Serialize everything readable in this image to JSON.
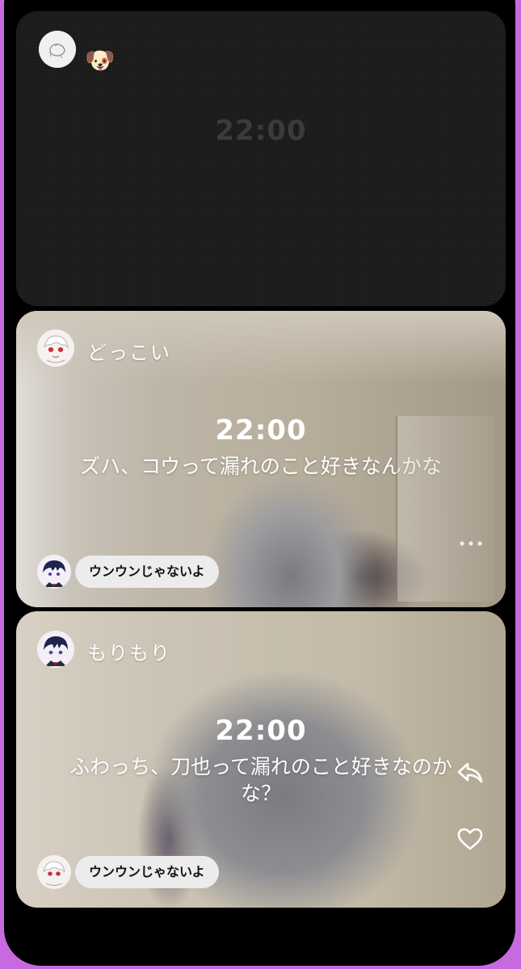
{
  "posts": [
    {
      "username": "",
      "emoji": "🐶",
      "time": "22:00",
      "caption": "",
      "reply": null
    },
    {
      "username": "どっこい",
      "time": "22:00",
      "caption": "ズハ、コウって漏れのこと好きなんかな",
      "reply": {
        "text": "ウンウンじゃないよ"
      }
    },
    {
      "username": "もりもり",
      "time": "22:00",
      "caption": "ふわっち、刀也って漏れのこと好きなのかな？",
      "reply": {
        "text": "ウンウンじゃないよ"
      }
    }
  ],
  "colors": {
    "frame": "#c86adf",
    "background": "#000000",
    "pill": "#ececec"
  },
  "icons": [
    "sketch-avatar-icon",
    "dog-emoji",
    "more-icon",
    "reply-arrow-icon",
    "heart-icon"
  ]
}
